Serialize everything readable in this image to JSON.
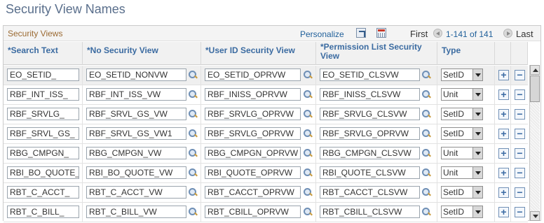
{
  "page": {
    "title": "Security View Names"
  },
  "grid": {
    "title": "Security Views",
    "personalize": "Personalize",
    "nav": {
      "first": "First",
      "range": "1-141 of 141",
      "last": "Last"
    },
    "columns": {
      "search": "*Search Text",
      "nosec": "*No Security View",
      "userid": "*User ID Security View",
      "perm": "*Permission List Security View",
      "type": "Type"
    },
    "rows": [
      {
        "search": "EO_SETID_",
        "nosec": "EO_SETID_NONVW",
        "userid": "EO_SETID_OPRVW",
        "perm": "EO_SETID_CLSVW",
        "type": "SetID"
      },
      {
        "search": "RBF_INT_ISS_",
        "nosec": "RBF_INT_ISS_VW",
        "userid": "RBF_INISS_OPRVW",
        "perm": "RBF_INISS_CLSVW",
        "type": "Unit"
      },
      {
        "search": "RBF_SRVLG_",
        "nosec": "RBF_SRVL_GS_VW",
        "userid": "RBF_SRVLG_OPRVW",
        "perm": "RBF_SRVLG_CLSVW",
        "type": "SetID"
      },
      {
        "search": "RBF_SRVL_GS_",
        "nosec": "RBF_SRVL_GS_VW1",
        "userid": "RBF_SRVLG_OPRVW",
        "perm": "RBF_SRVLG_OPRVW",
        "type": "SetID"
      },
      {
        "search": "RBG_CMPGN_",
        "nosec": "RBG_CMPGN_VW",
        "userid": "RBG_CMPGN_OPRVW",
        "perm": "RBG_CMPGN_CLSVW",
        "type": "Unit"
      },
      {
        "search": "RBI_BO_QUOTE_",
        "nosec": "RBI_BO_QUOTE_VW",
        "userid": "RBI_QUOTE_OPRVW",
        "perm": "RBI_QUOTE_CLSVW",
        "type": "Unit"
      },
      {
        "search": "RBT_C_ACCT_",
        "nosec": "RBT_C_ACCT_VW",
        "userid": "RBT_CACCT_OPRVW",
        "perm": "RBT_CACCT_CLSVW",
        "type": "SetID"
      },
      {
        "search": "RBT_C_BILL_",
        "nosec": "RBT_C_BILL_VW",
        "userid": "RBT_CBILL_OPRVW",
        "perm": "RBT_CBILL_CLSVW",
        "type": "SetID"
      }
    ]
  },
  "icons": {
    "lookup": "magnifier-icon",
    "add": "plus-icon",
    "delete": "minus-icon",
    "view_all": "view-all-icon",
    "download": "download-icon"
  },
  "buttons": {
    "add": "+",
    "delete": "−"
  }
}
